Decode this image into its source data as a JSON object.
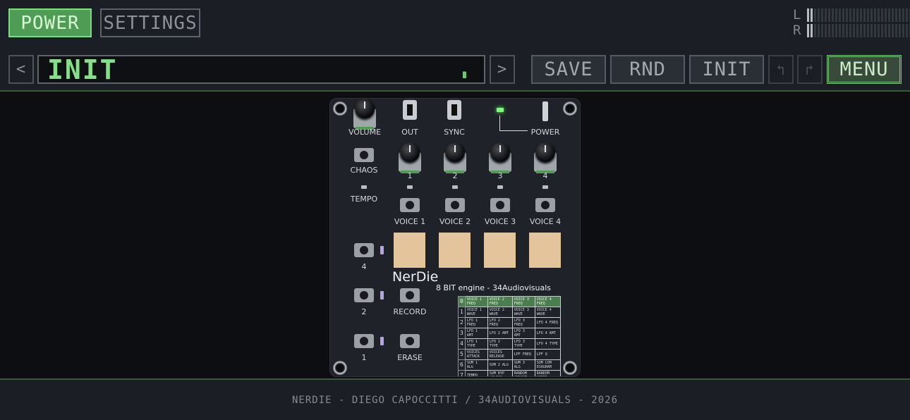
{
  "header": {
    "power_label": "POWER",
    "settings_label": "SETTINGS",
    "meter": {
      "left_label": "L",
      "right_label": "R",
      "left_level": 0.05,
      "right_level": 0.05
    }
  },
  "preset_bar": {
    "prev_label": "<",
    "name": "INIT",
    "cursor": "▖",
    "next_label": ">",
    "save_label": "SAVE",
    "rnd_label": "RND",
    "init_label": "INIT",
    "undo_label": "↰",
    "redo_label": "↱",
    "menu_label": "MENU"
  },
  "device": {
    "labels": {
      "volume": "VOLUME",
      "out": "OUT",
      "sync": "SYNC",
      "power": "POWER",
      "chaos": "CHAOS",
      "tempo": "TEMPO",
      "record": "RECORD",
      "erase": "ERASE"
    },
    "knob_numbers": [
      "1",
      "2",
      "3",
      "4"
    ],
    "voice_buttons": [
      "VOICE 1",
      "VOICE 2",
      "VOICE 3",
      "VOICE 4"
    ],
    "side_buttons": [
      "4",
      "2",
      "1"
    ],
    "brand": "NerDie",
    "subtitle": "8 BIT engine - 34Audiovisuals",
    "param_table": [
      {
        "idx": "0",
        "cells": [
          "VOICE 1 FREQ",
          "VOICE 2 FREQ",
          "VOICE 3 FREQ",
          "VOICE 4 FREQ"
        ]
      },
      {
        "idx": "1",
        "cells": [
          "VOICE 1 WAVE",
          "VOICE 2 WAVE",
          "VOICE 3 WAVE",
          "VOICE 4 WAVE"
        ]
      },
      {
        "idx": "2",
        "cells": [
          "LFO 1 FREQ",
          "LFO 2 FREQ",
          "LFO 3 FREQ",
          "LFO 4 FREQ"
        ]
      },
      {
        "idx": "3",
        "cells": [
          "LFO 1 AMT",
          "LFO 2 AMT",
          "LFO 3 AMT",
          "LFO 4 AMT"
        ]
      },
      {
        "idx": "4",
        "cells": [
          "LFO 1 TYPE",
          "LFO 2 TYPE",
          "LFO 3 TYPE",
          "LFO 4 TYPE"
        ]
      },
      {
        "idx": "5",
        "cells": [
          "VOICES ATTACK",
          "VOICES RELEASE",
          "LPF FREQ",
          "LPF Q"
        ]
      },
      {
        "idx": "6",
        "cells": [
          "SUM 1 ALG",
          "SUM 2 ALG",
          "SUM 3 ALG",
          "SUM COM DIAGRAM"
        ]
      },
      {
        "idx": "7",
        "cells": [
          "TEMPO",
          "SUM BYP /CLICK",
          "RANDOM AMOUNT",
          "RANDOM SPEED"
        ]
      }
    ]
  },
  "footer": {
    "credit": "NERDIE - DIEGO CAPOCCITTI / 34AUDIOVISUALS - 2026"
  },
  "colors": {
    "accent_green": "#4f9d55",
    "preset_text": "#86e08a",
    "background": "#0d0e11",
    "panel": "#1b1e25",
    "pad_color": "#e3c49b"
  }
}
